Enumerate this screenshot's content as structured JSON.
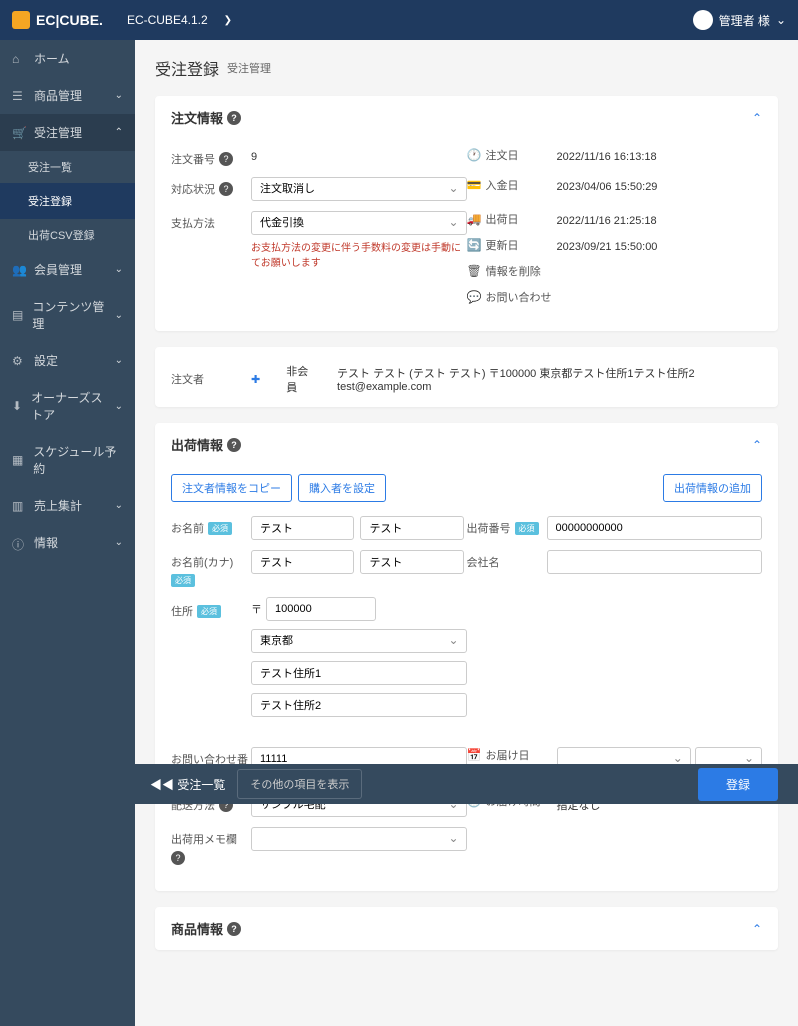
{
  "header": {
    "logo": "EC|CUBE.",
    "version": "EC-CUBE4.1.2",
    "chevron": "❯",
    "user_label": "管理者 様",
    "user_chevron": "⌄"
  },
  "sidebar": {
    "items": [
      {
        "label": "ホーム"
      },
      {
        "label": "商品管理"
      },
      {
        "label": "受注管理",
        "expanded": true,
        "sub": [
          {
            "label": "受注一覧"
          },
          {
            "label": "受注登録",
            "selected": true
          },
          {
            "label": "出荷CSV登録"
          }
        ]
      },
      {
        "label": "会員管理"
      },
      {
        "label": "コンテンツ管理"
      },
      {
        "label": "設定"
      },
      {
        "label": "オーナーズストア"
      },
      {
        "label": "スケジュール予約"
      },
      {
        "label": "売上集計"
      },
      {
        "label": "情報"
      }
    ]
  },
  "page": {
    "title": "受注登録",
    "subtitle": "受注管理"
  },
  "order_info": {
    "panel_title": "注文情報",
    "order_no_label": "注文番号",
    "order_no": "9",
    "status_label": "対応状況",
    "status_value": "注文取消し",
    "payment_label": "支払方法",
    "payment_value": "代金引換",
    "payment_warning": "お支払方法の変更に伴う手数料の変更は手動にてお願いします",
    "order_date_label": "注文日",
    "order_date": "2022/11/16 16:13:18",
    "payment_date_label": "入金日",
    "payment_date": "2023/04/06 15:50:29",
    "ship_date_label": "出荷日",
    "ship_date": "2022/11/16 21:25:18",
    "update_date_label": "更新日",
    "update_date": "2023/09/21 15:50:00",
    "clear_label": "情報を削除",
    "inquiry_label": "お問い合わせ"
  },
  "orderer": {
    "label": "注文者",
    "non_member": "非会員",
    "summary": "テスト テスト (テスト テスト) 〒100000 東京都テスト住所1テスト住所2 test@example.com"
  },
  "shipping": {
    "panel_title": "出荷情報",
    "copy_btn": "注文者情報をコピー",
    "member_btn": "購入者を設定",
    "add_btn": "出荷情報の追加",
    "name_label": "お名前",
    "name_sei": "テスト",
    "name_mei": "テスト",
    "kana_label": "お名前(カナ)",
    "kana_sei": "テスト",
    "kana_mei": "テスト",
    "tracking_label": "出荷番号",
    "tracking": "00000000000",
    "company_label": "会社名",
    "addr_label": "住所",
    "zip_prefix": "〒",
    "zip": "100000",
    "pref": "東京都",
    "addr1": "テスト住所1",
    "addr2": "テスト住所2",
    "tel_label": "お問い合わせ番号",
    "tel": "11111",
    "delivery_date_label": "お届け日",
    "delivery_time_label": "お届け時間",
    "delivery_time": "指定なし",
    "method_label": "配送方法",
    "method": "サンプル宅配",
    "note_label": "出荷用メモ欄"
  },
  "product": {
    "panel_title": "商品情報"
  },
  "footer": {
    "back": "受注一覧",
    "keep": "その他の項目を表示",
    "save": "登録"
  },
  "required": "必須"
}
